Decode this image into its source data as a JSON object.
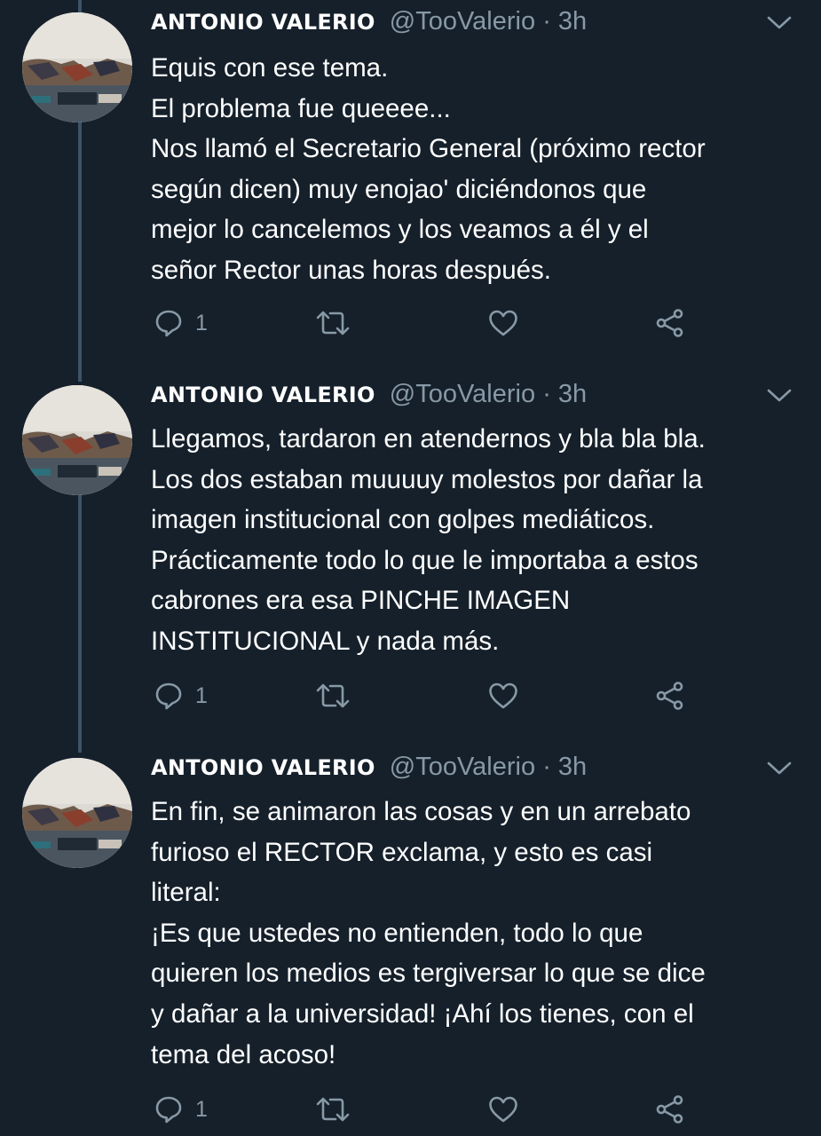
{
  "tweets": [
    {
      "author": {
        "name": "ANTONIO VALERIO",
        "handle": "@TooValerio",
        "separator": "·",
        "time": "3h"
      },
      "lines": [
        "Equis con ese tema.",
        "El problema fue queeee...",
        "Nos llamó el Secretario General (próximo rector",
        "según dicen) muy enojao' diciéndonos que",
        "mejor lo cancelemos y los veamos a él y el",
        "señor Rector unas horas después."
      ],
      "reply_count": "1"
    },
    {
      "author": {
        "name": "ANTONIO VALERIO",
        "handle": "@TooValerio",
        "separator": "·",
        "time": "3h"
      },
      "lines": [
        "Llegamos, tardaron en atendernos y bla bla bla.",
        "Los dos estaban muuuuy molestos por dañar la",
        "imagen institucional con golpes mediáticos.",
        "Prácticamente todo lo que le importaba a estos",
        "cabrones era esa PINCHE IMAGEN",
        "INSTITUCIONAL y nada más."
      ],
      "reply_count": "1"
    },
    {
      "author": {
        "name": "ANTONIO VALERIO",
        "handle": "@TooValerio",
        "separator": "·",
        "time": "3h"
      },
      "lines": [
        "En fin, se animaron las cosas y en un arrebato",
        "furioso el RECTOR exclama, y esto es casi",
        "literal:",
        "¡Es que ustedes no entienden, todo lo que",
        "quieren los medios es tergiversar lo que se dice",
        "y dañar a la universidad! ¡Ahí los tienes, con el",
        "tema del acoso!"
      ],
      "reply_count": "1"
    }
  ],
  "icons": {
    "reply": "reply-icon",
    "retweet": "retweet-icon",
    "like": "heart-icon",
    "share": "share-icon",
    "menu": "chevron-down-icon"
  },
  "colors": {
    "background": "#15202b",
    "text": "#ffffff",
    "secondary_text": "#8899a6",
    "thread_line": "#3d5466"
  }
}
